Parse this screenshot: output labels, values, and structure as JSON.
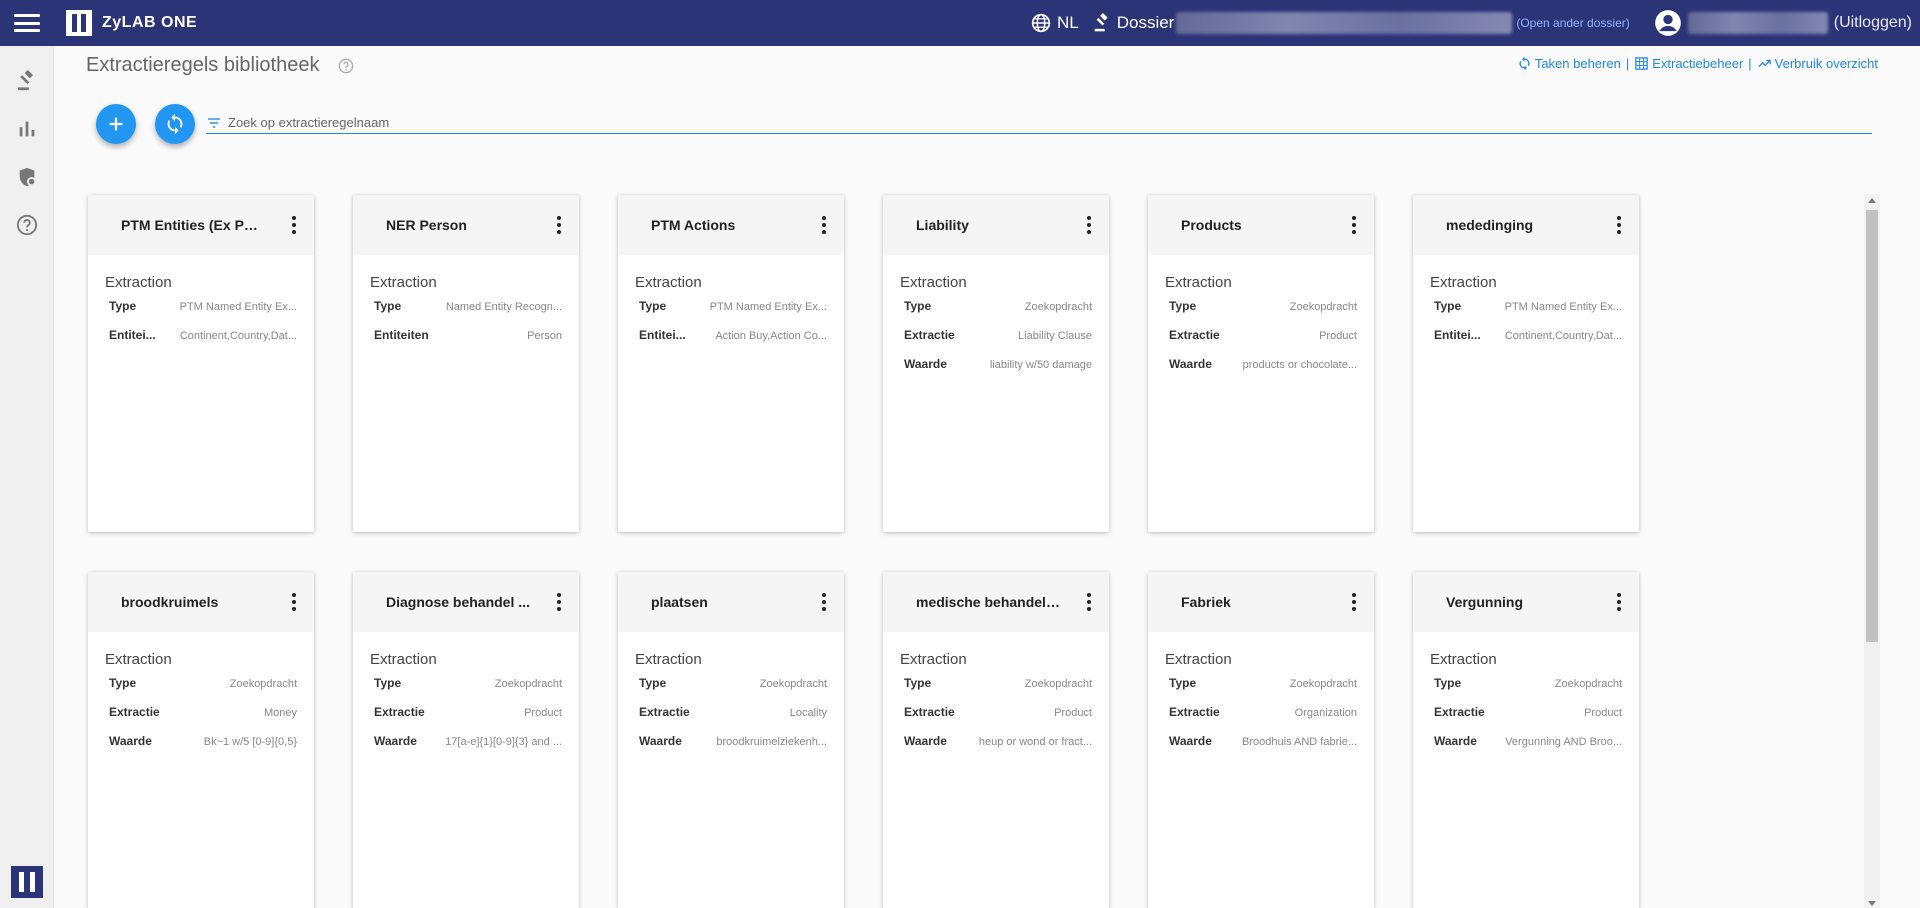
{
  "app": {
    "name": "ZyLAB ONE"
  },
  "header": {
    "language": "NL",
    "dossier_label": "Dossier",
    "open_other_dossier": "(Open ander dossier)",
    "logout": "(Uitloggen)"
  },
  "page": {
    "title": "Extractieregels bibliotheek",
    "links": {
      "manage_tasks": "Taken beheren",
      "extraction_management": "Extractiebeheer",
      "usage_overview": "Verbruik overzicht",
      "separator": "|"
    },
    "search": {
      "placeholder": "Zoek op extractieregelnaam"
    }
  },
  "cards": [
    {
      "title": "PTM Entities (Ex Per...",
      "subtitle": "Extraction",
      "rows": [
        {
          "label": "Type",
          "value": "PTM Named Entity Ex..."
        },
        {
          "label": "Entitei...",
          "value": "Continent,Country,Dat..."
        }
      ]
    },
    {
      "title": "NER Person",
      "subtitle": "Extraction",
      "rows": [
        {
          "label": "Type",
          "value": "Named Entity Recogn..."
        },
        {
          "label": "Entiteiten",
          "value": "Person"
        }
      ]
    },
    {
      "title": "PTM Actions",
      "subtitle": "Extraction",
      "rows": [
        {
          "label": "Type",
          "value": "PTM Named Entity Ex..."
        },
        {
          "label": "Entitei...",
          "value": "Action Buy,Action Co..."
        }
      ]
    },
    {
      "title": "Liability",
      "subtitle": "Extraction",
      "rows": [
        {
          "label": "Type",
          "value": "Zoekopdracht"
        },
        {
          "label": "Extractie",
          "value": "Liability Clause"
        },
        {
          "label": "Waarde",
          "value": "liability w/50 damage"
        }
      ]
    },
    {
      "title": "Products",
      "subtitle": "Extraction",
      "rows": [
        {
          "label": "Type",
          "value": "Zoekopdracht"
        },
        {
          "label": "Extractie",
          "value": "Product"
        },
        {
          "label": "Waarde",
          "value": "products or chocolate..."
        }
      ]
    },
    {
      "title": "mededinging",
      "subtitle": "Extraction",
      "rows": [
        {
          "label": "Type",
          "value": "PTM Named Entity Ex..."
        },
        {
          "label": "Entitei...",
          "value": "Continent,Country,Dat..."
        }
      ]
    },
    {
      "title": "broodkruimels",
      "subtitle": "Extraction",
      "rows": [
        {
          "label": "Type",
          "value": "Zoekopdracht"
        },
        {
          "label": "Extractie",
          "value": "Money"
        },
        {
          "label": "Waarde",
          "value": "Bk~1 w/5 [0-9]{0,5}"
        }
      ]
    },
    {
      "title": "Diagnose behandel ...",
      "subtitle": "Extraction",
      "rows": [
        {
          "label": "Type",
          "value": "Zoekopdracht"
        },
        {
          "label": "Extractie",
          "value": "Product"
        },
        {
          "label": "Waarde",
          "value": "17[a-e]{1}[0-9]{3} and ..."
        }
      ]
    },
    {
      "title": "plaatsen",
      "subtitle": "Extraction",
      "rows": [
        {
          "label": "Type",
          "value": "Zoekopdracht"
        },
        {
          "label": "Extractie",
          "value": "Locality"
        },
        {
          "label": "Waarde",
          "value": "broodkruimelziekenh..."
        }
      ]
    },
    {
      "title": "medische behandeli...",
      "subtitle": "Extraction",
      "rows": [
        {
          "label": "Type",
          "value": "Zoekopdracht"
        },
        {
          "label": "Extractie",
          "value": "Product"
        },
        {
          "label": "Waarde",
          "value": "heup or wond or fract..."
        }
      ]
    },
    {
      "title": "Fabriek",
      "subtitle": "Extraction",
      "rows": [
        {
          "label": "Type",
          "value": "Zoekopdracht"
        },
        {
          "label": "Extractie",
          "value": "Organization"
        },
        {
          "label": "Waarde",
          "value": "Broodhuis AND fabrie..."
        }
      ]
    },
    {
      "title": "Vergunning",
      "subtitle": "Extraction",
      "rows": [
        {
          "label": "Type",
          "value": "Zoekopdracht"
        },
        {
          "label": "Extractie",
          "value": "Product"
        },
        {
          "label": "Waarde",
          "value": "Vergunning AND Broo..."
        }
      ]
    }
  ],
  "icons": {
    "menu": "hamburger-icon",
    "globe": "globe-icon",
    "gavel": "gavel-icon",
    "user": "account-circle-icon",
    "add": "plus-icon",
    "refresh": "sync-icon",
    "filter": "filter-icon"
  },
  "colors": {
    "header": "#2c3478",
    "accent": "#2196f3",
    "link": "#1e88e5"
  }
}
